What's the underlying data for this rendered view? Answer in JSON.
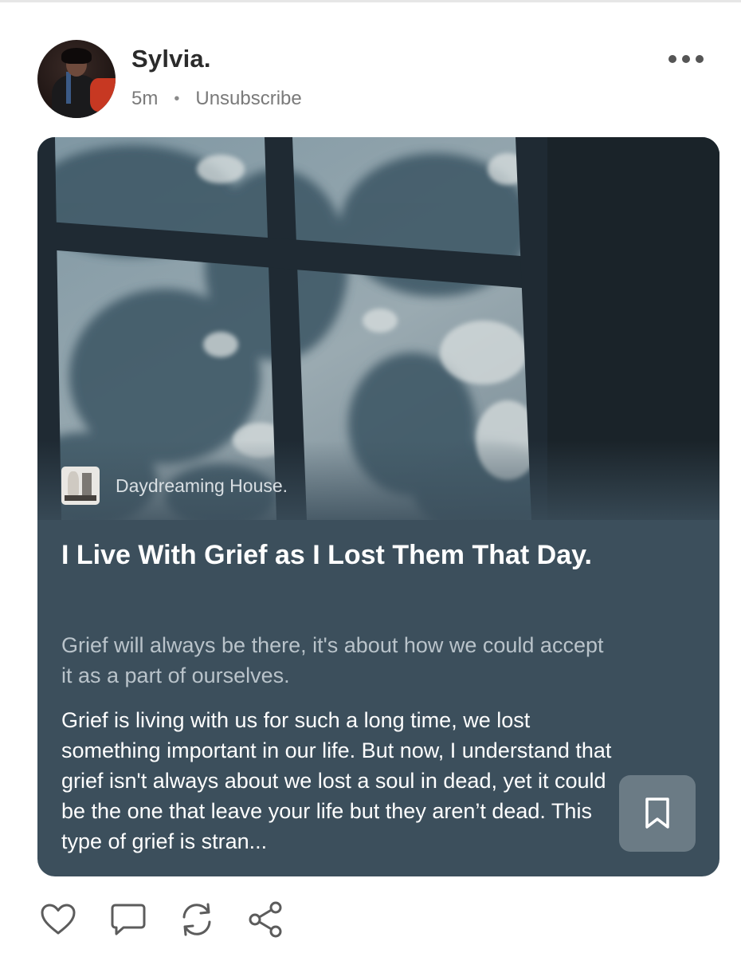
{
  "author": {
    "name": "Sylvia.",
    "time_ago": "5m",
    "separator": "•",
    "unsubscribe_label": "Unsubscribe"
  },
  "post": {
    "publication_name": "Daydreaming House.",
    "title": "I Live With Grief as I Lost Them That Day.",
    "subtitle": "Grief will always be there, it's about how we could accept it as a part of ourselves.",
    "excerpt": "Grief is living with us for such a long time, we lost something important in our life. But now, I understand that grief isn't always about we lost a soul in dead, yet it could be the one that leave your life but they aren’t dead. This type of grief is stran..."
  },
  "icons": {
    "more": "more-horizontal-icon",
    "bookmark": "bookmark-icon",
    "like": "heart-icon",
    "comment": "comment-icon",
    "restack": "restack-icon",
    "share": "share-icon"
  },
  "colors": {
    "card_background": "#3c4f5c",
    "bookmark_background": "#6b7b85",
    "author_name": "#2b2b2b",
    "meta_text": "#7a7a7a"
  }
}
